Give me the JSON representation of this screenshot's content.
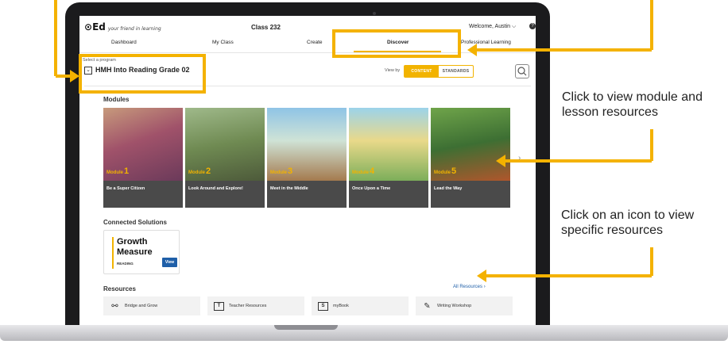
{
  "app": {
    "logo_text": "Ed",
    "logo_tagline": "your friend in learning",
    "class_name": "Class 232",
    "welcome": "Welcome, Austin",
    "help_icon": "help-icon"
  },
  "nav": {
    "items": [
      "Dashboard",
      "My Class",
      "Create",
      "Discover",
      "Professional Learning"
    ],
    "active": "Discover"
  },
  "program": {
    "label": "Select a program",
    "value": "HMH Into Reading Grade 02"
  },
  "viewby": {
    "label": "View by",
    "options": [
      "CONTENT",
      "STANDARDS"
    ],
    "selected": "CONTENT"
  },
  "modules": {
    "heading": "Modules",
    "module_word": "Module",
    "items": [
      {
        "number": "1",
        "title": "Be a Super Citizen"
      },
      {
        "number": "2",
        "title": "Look Around and Explore!"
      },
      {
        "number": "3",
        "title": "Meet in the Middle"
      },
      {
        "number": "4",
        "title": "Once Upon a Time"
      },
      {
        "number": "5",
        "title": "Lead the Way"
      }
    ]
  },
  "connected": {
    "heading": "Connected Solutions",
    "card_line1": "Growth",
    "card_line2": "Measure",
    "card_sub": "READING",
    "button": "View"
  },
  "resources": {
    "heading": "Resources",
    "all_link": "All Resources",
    "items": [
      {
        "label": "Bridge and Grow",
        "icon": "link-nodes-icon"
      },
      {
        "label": "Teacher Resources",
        "icon": "t-box-icon"
      },
      {
        "label": "myBook",
        "icon": "book-box-icon"
      },
      {
        "label": "Writing Workshop",
        "icon": "pencil-icon"
      }
    ]
  },
  "callouts": {
    "module_tip": "Click to view module and lesson resources",
    "icon_tip": "Click on an icon to view specific resources"
  },
  "colors": {
    "accent": "#f2b300",
    "callout": "#f4b200",
    "link": "#1f5fa8"
  }
}
